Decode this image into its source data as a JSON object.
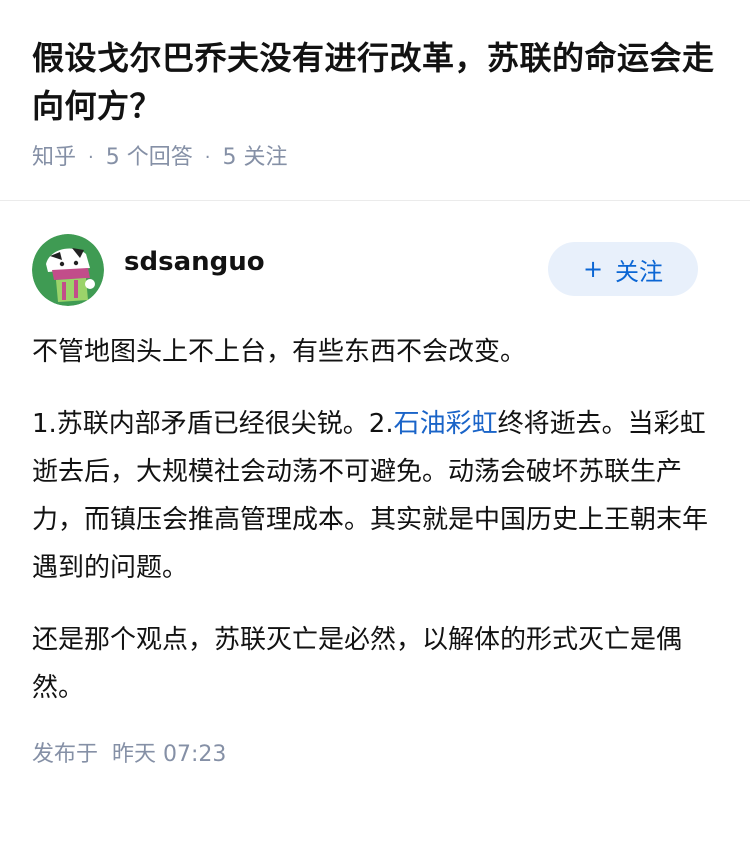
{
  "question": {
    "title": "假设戈尔巴乔夫没有进行改革，苏联的命运会走向何方？",
    "source": "知乎",
    "answers_count": "5 个回答",
    "followers_count": "5 关注",
    "separator": "·"
  },
  "answer": {
    "author": {
      "name": "sdsanguo",
      "avatar_icon": "avatar-cartoon-icon"
    },
    "follow_button": {
      "icon": "plus-icon",
      "plus": "+",
      "label": "关注"
    },
    "paragraphs": [
      {
        "text": "不管地图头上不上台，有些东西不会改变。"
      },
      {
        "before_link": "1.苏联内部矛盾已经很尖锐。2.",
        "link_text": "石油彩虹",
        "after_link": "终将逝去。当彩虹逝去后，大规模社会动荡不可避免。动荡会破坏苏联生产力，而镇压会推高管理成本。其实就是中国历史上王朝末年遇到的问题。"
      },
      {
        "text": "还是那个观点，苏联灭亡是必然，以解体的形式灭亡是偶然。"
      }
    ],
    "publish": {
      "prefix": "发布于",
      "time": "昨天 07:23"
    }
  },
  "colors": {
    "title": "#121212",
    "meta": "#8590a6",
    "link": "#1a64c8",
    "follow_bg": "#e8f0fb",
    "follow_text": "#0b66d4",
    "avatar_bg": "#3f9b53"
  }
}
